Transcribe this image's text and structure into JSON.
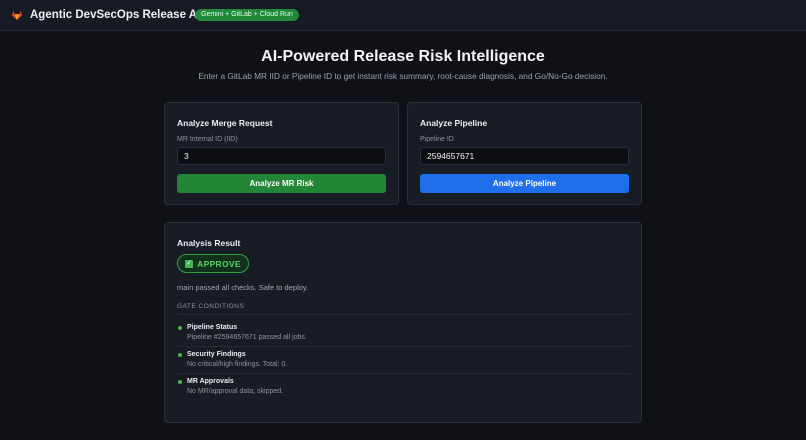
{
  "header": {
    "icon": "gitlab-fox-icon",
    "title": "Agentic DevSecOps Release Assistant",
    "badge": "Gemini + GitLab + Cloud Run"
  },
  "hero": {
    "title": "AI-Powered Release Risk Intelligence",
    "subtitle": "Enter a GitLab MR IID or Pipeline ID to get instant risk summary, root-cause diagnosis, and Go/No-Go decision."
  },
  "merge_request": {
    "title": "Analyze Merge Request",
    "field_label": "MR Internal ID (IID)",
    "value": "3",
    "button": "Analyze MR Risk"
  },
  "pipeline": {
    "title": "Analyze Pipeline",
    "field_label": "Pipeline ID",
    "value": "2594657671",
    "button": "Analyze Pipeline"
  },
  "result": {
    "title": "Analysis Result",
    "verdict": "APPROVE",
    "verdict_icon": "check-icon",
    "summary": "main passed all checks. Safe to deploy.",
    "gate_heading": "GATE CONDITIONS",
    "gates": [
      {
        "name": "Pipeline Status",
        "detail": "Pipeline #2594657671 passed all jobs."
      },
      {
        "name": "Security Findings",
        "detail": "No critical/high findings. Total: 0."
      },
      {
        "name": "MR Approvals",
        "detail": "No MR/approval data; skipped."
      }
    ]
  },
  "colors": {
    "background": "#0f1117",
    "accent_green": "#238636",
    "accent_blue": "#1f6feb",
    "status_pass": "#3fb950"
  }
}
